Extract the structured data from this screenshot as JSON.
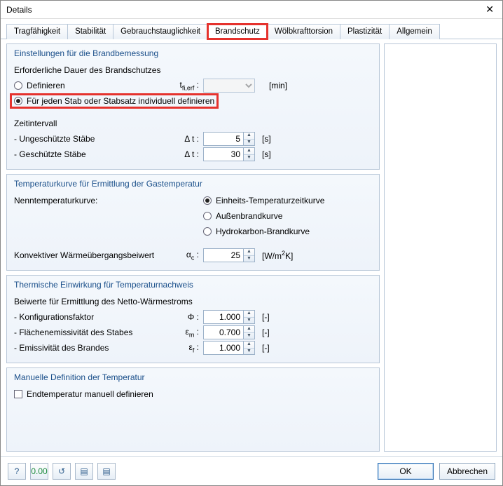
{
  "window": {
    "title": "Details"
  },
  "tabs": [
    {
      "label": "Tragfähigkeit"
    },
    {
      "label": "Stabilität"
    },
    {
      "label": "Gebrauchstauglichkeit"
    },
    {
      "label": "Brandschutz",
      "active": true,
      "highlight": true
    },
    {
      "label": "Wölbkrafttorsion"
    },
    {
      "label": "Plastizität"
    },
    {
      "label": "Allgemein"
    }
  ],
  "group_settings": {
    "title": "Einstellungen für die Brandbemessung",
    "duration_label": "Erforderliche Dauer des Brandschutzes",
    "define_label": "Definieren",
    "define_sym_html": "t<sub>fi,erf</sub> :",
    "define_unit": "[min]",
    "per_member_label": "Für jeden Stab oder Stabsatz individuell definieren",
    "interval_label": "Zeitintervall",
    "unprotected_label": "- Ungeschützte Stäbe",
    "protected_label": "- Geschützte Stäbe",
    "dt_sym": "Δ t :",
    "dt_unprot_value": "5",
    "dt_prot_value": "30",
    "dt_unit": "[s]"
  },
  "group_temp": {
    "title": "Temperaturkurve für Ermittlung der Gastemperatur",
    "curve_label": "Nenntemperaturkurve:",
    "opt_einheits": "Einheits-Temperaturzeitkurve",
    "opt_aussen": "Außenbrandkurve",
    "opt_hydro": "Hydrokarbon-Brandkurve",
    "alpha_label": "Konvektiver Wärmeübergangsbeiwert",
    "alpha_sym_html": "α<sub>c</sub> :",
    "alpha_value": "25",
    "alpha_unit_html": "[W/m<sup>2</sup>K]"
  },
  "group_thermal": {
    "title": "Thermische Einwirkung für Temperaturnachweis",
    "beiwerte_label": "Beiwerte für Ermittlung des Netto-Wärmestroms",
    "phi_label": "- Konfigurationsfaktor",
    "phi_sym": "Φ :",
    "phi_value": "1.000",
    "eps_m_label": "- Flächenemissivität des Stabes",
    "eps_m_sym_html": "ε<sub>m</sub> :",
    "eps_m_value": "0.700",
    "eps_f_label": "- Emissivität des Brandes",
    "eps_f_sym_html": "ε<sub>f</sub> :",
    "eps_f_value": "1.000",
    "dimless_unit": "[-]"
  },
  "group_manual": {
    "title": "Manuelle Definition der Temperatur",
    "check_label": "Endtemperatur manuell definieren"
  },
  "footer": {
    "ok": "OK",
    "cancel": "Abbrechen"
  }
}
